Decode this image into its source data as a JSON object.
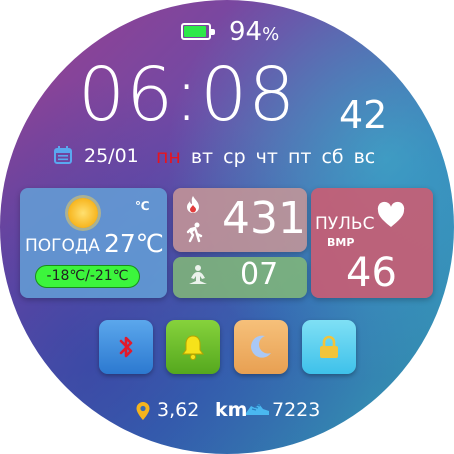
{
  "battery": {
    "percent_value": "94",
    "percent_sign": "%",
    "level": 0.94,
    "color": "#2ee84a"
  },
  "time": {
    "hours_minutes": "06:08",
    "seconds": "42"
  },
  "date": {
    "text": "25/01",
    "weekdays": [
      "пн",
      "вт",
      "ср",
      "чт",
      "пт",
      "сб",
      "вс"
    ],
    "active_weekday_index": 0,
    "active_color": "#e8141e"
  },
  "weather": {
    "unit": "℃",
    "label": "ПОГОДА",
    "temperature": "27℃",
    "range": "-18℃/-21℃",
    "icon": "sun-icon"
  },
  "activity": {
    "steps": "431",
    "yoga": "07",
    "icons": [
      "fire-icon",
      "running-icon",
      "yoga-icon"
    ]
  },
  "pulse": {
    "label": "ПУЛЬС",
    "unit": "BMP",
    "value": "46",
    "icon": "heart-icon"
  },
  "apps": [
    {
      "name": "bluetooth",
      "icon": "bluetooth-icon",
      "color": "#2c79d0"
    },
    {
      "name": "alarm",
      "icon": "bell-icon",
      "color": "#55a81e"
    },
    {
      "name": "night-mode",
      "icon": "moon-icon",
      "color": "#e8a052"
    },
    {
      "name": "lock",
      "icon": "lock-icon",
      "color": "#3ec1ea"
    }
  ],
  "footer": {
    "distance": "3,62",
    "distance_unit": "km",
    "total_steps": "7223"
  }
}
